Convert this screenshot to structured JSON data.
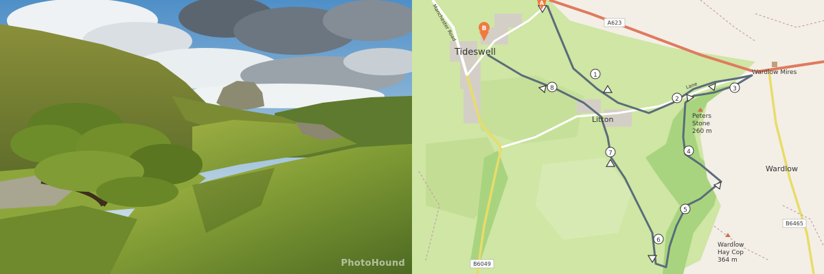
{
  "photo": {
    "watermark": "PhotoHound"
  },
  "map": {
    "places": {
      "tideswell": "Tideswell",
      "litton": "Litton",
      "wardlow": "Wardlow",
      "wardlow_mires": "Wardlow Mires",
      "peters_stone": "Peters",
      "peters_stone_2": "Stone",
      "peters_stone_elev": "260 m",
      "wardlow_hay_cop": "Wardlow",
      "wardlow_hay_cop_2": "Hay Cop",
      "wardlow_hay_cop_elev": "364 m"
    },
    "roads": {
      "a623": "A623",
      "b6465": "B6465",
      "b6049": "B6049",
      "manchester_road": "Manchester Road",
      "lane": "Lane"
    },
    "markers": {
      "start": "A",
      "end": "B"
    },
    "waypoints": [
      "1",
      "2",
      "3",
      "4",
      "5",
      "6",
      "7",
      "8"
    ],
    "colors": {
      "route": "#556677",
      "major_road": "#e07a5f",
      "secondary_road": "#ddd98a",
      "marker": "#f07b3f",
      "green_field": "#cfe6a4",
      "woodland": "#a9d47f"
    }
  }
}
